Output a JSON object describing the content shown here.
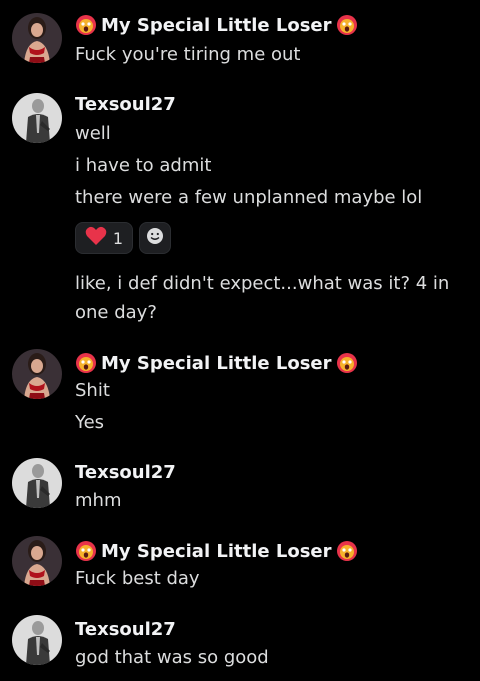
{
  "users": {
    "loser": "My Special Little Loser",
    "tex": "Texsoul27"
  },
  "messages": [
    {
      "author": "loser",
      "lines": [
        "Fuck you're tiring me out"
      ]
    },
    {
      "author": "tex",
      "lines": [
        "well",
        "i have to admit",
        "there were a few unplanned maybe lol",
        "like, i def didn't expect...what was it?  4 in",
        "one day?"
      ]
    },
    {
      "author": "loser",
      "lines": [
        "Shit",
        "Yes"
      ]
    },
    {
      "author": "tex",
      "lines": [
        "mhm"
      ]
    },
    {
      "author": "loser",
      "lines": [
        "Fuck best day"
      ]
    },
    {
      "author": "tex",
      "lines": [
        "god that was so good"
      ]
    }
  ],
  "reaction": {
    "emoji": "heart-icon",
    "count": "1"
  },
  "icons": {
    "name_emoji": "face-screaming-hot-icon",
    "add_reaction": "add-reaction-smiley-icon"
  },
  "colors": {
    "background": "#000000",
    "heart": "#e8334a",
    "emoji_face": "#f6b22c"
  }
}
